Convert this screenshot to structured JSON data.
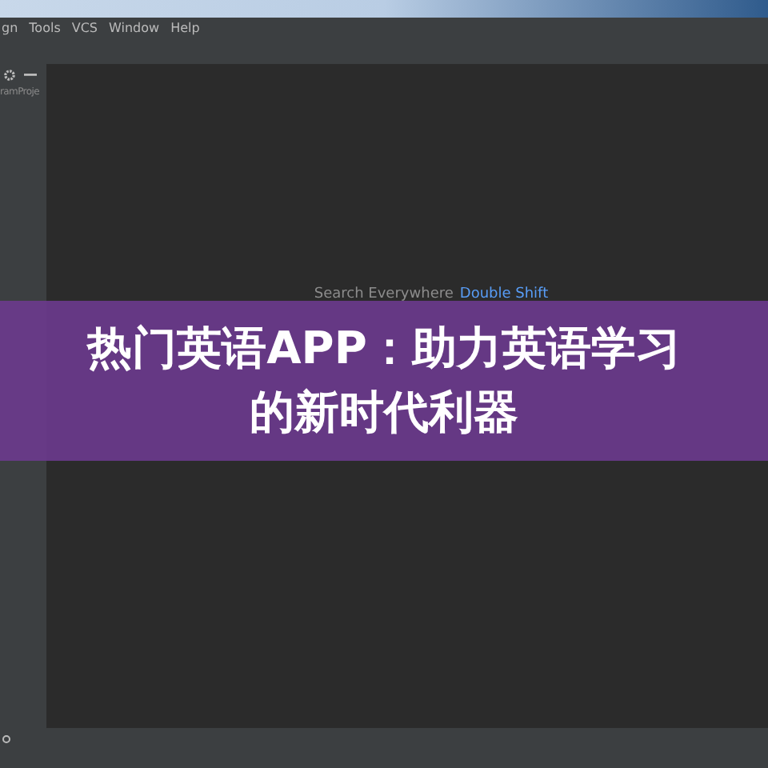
{
  "menu_bar": {
    "items": [
      "gn",
      "Tools",
      "VCS",
      "Window",
      "Help"
    ]
  },
  "sidebar": {
    "label": "ramProje"
  },
  "editor": {
    "hints": [
      {
        "action": "Search Everywhere",
        "shortcut": "Double Shift"
      }
    ]
  },
  "banner": {
    "lines": [
      "热门英语APP：助力英语学习",
      "的新时代利器"
    ]
  }
}
